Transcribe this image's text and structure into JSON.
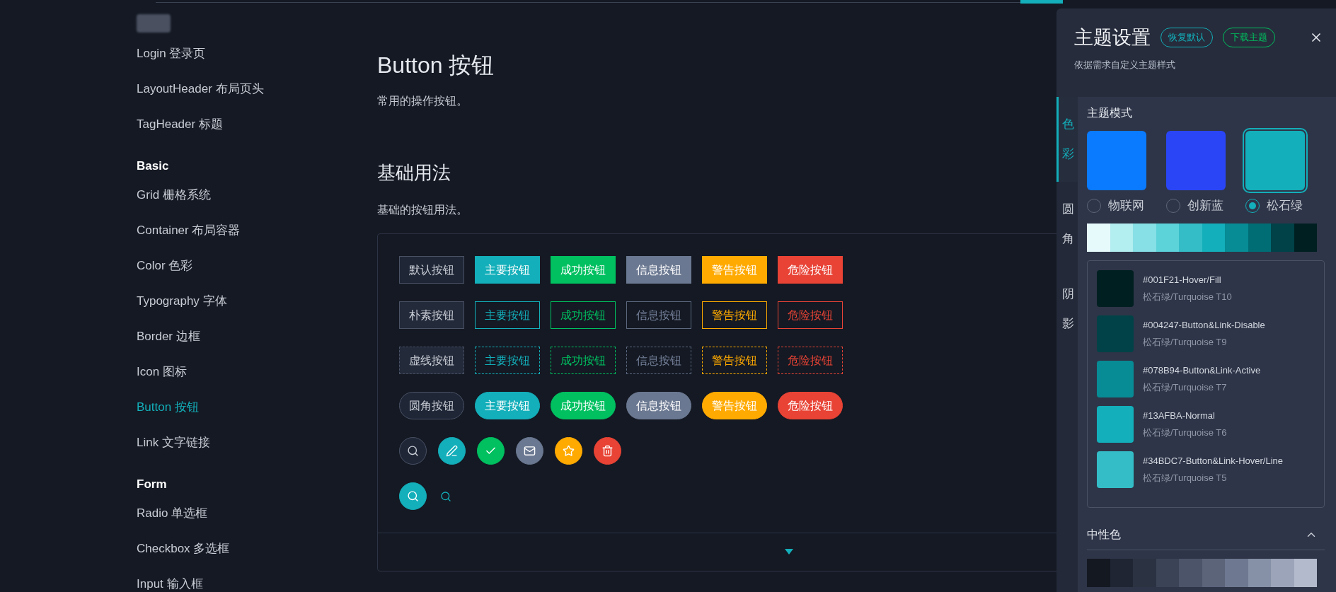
{
  "sidebar": {
    "items": [
      {
        "kind": "link",
        "label": "Login 登录页",
        "selected": false
      },
      {
        "kind": "link",
        "label": "LayoutHeader 布局页头",
        "selected": false
      },
      {
        "kind": "link",
        "label": "TagHeader 标题",
        "selected": false
      },
      {
        "kind": "heading",
        "label": "Basic"
      },
      {
        "kind": "link",
        "label": "Grid 栅格系统",
        "selected": false
      },
      {
        "kind": "link",
        "label": "Container 布局容器",
        "selected": false
      },
      {
        "kind": "link",
        "label": "Color 色彩",
        "selected": false
      },
      {
        "kind": "link",
        "label": "Typography 字体",
        "selected": false
      },
      {
        "kind": "link",
        "label": "Border 边框",
        "selected": false
      },
      {
        "kind": "link",
        "label": "Icon 图标",
        "selected": false
      },
      {
        "kind": "link",
        "label": "Button 按钮",
        "selected": true
      },
      {
        "kind": "link",
        "label": "Link 文字链接",
        "selected": false
      },
      {
        "kind": "heading",
        "label": "Form"
      },
      {
        "kind": "link",
        "label": "Radio 单选框",
        "selected": false
      },
      {
        "kind": "link",
        "label": "Checkbox 多选框",
        "selected": false
      },
      {
        "kind": "link",
        "label": "Input 输入框",
        "selected": false
      }
    ]
  },
  "page": {
    "title": "Button 按钮",
    "description": "常用的操作按钮。",
    "section": {
      "title": "基础用法",
      "description": "基础的按钮用法。",
      "demo": {
        "button_rows": [
          {
            "kind": "solid",
            "buttons": [
              {
                "kind": "default",
                "label": "默认按钮"
              },
              {
                "kind": "primary",
                "label": "主要按钮"
              },
              {
                "kind": "success",
                "label": "成功按钮"
              },
              {
                "kind": "info",
                "label": "信息按钮"
              },
              {
                "kind": "warning",
                "label": "警告按钮"
              },
              {
                "kind": "danger",
                "label": "危险按钮"
              }
            ]
          },
          {
            "kind": "plain",
            "buttons": [
              {
                "kind": "default",
                "label": "朴素按钮"
              },
              {
                "kind": "primary",
                "label": "主要按钮"
              },
              {
                "kind": "success",
                "label": "成功按钮"
              },
              {
                "kind": "info",
                "label": "信息按钮"
              },
              {
                "kind": "warning",
                "label": "警告按钮"
              },
              {
                "kind": "danger",
                "label": "危险按钮"
              }
            ]
          },
          {
            "kind": "dashed",
            "buttons": [
              {
                "kind": "default",
                "label": "虚线按钮"
              },
              {
                "kind": "primary",
                "label": "主要按钮"
              },
              {
                "kind": "success",
                "label": "成功按钮"
              },
              {
                "kind": "info",
                "label": "信息按钮"
              },
              {
                "kind": "warning",
                "label": "警告按钮"
              },
              {
                "kind": "danger",
                "label": "危险按钮"
              }
            ]
          },
          {
            "kind": "round",
            "buttons": [
              {
                "kind": "default",
                "label": "圆角按钮"
              },
              {
                "kind": "primary",
                "label": "主要按钮"
              },
              {
                "kind": "success",
                "label": "成功按钮"
              },
              {
                "kind": "info",
                "label": "信息按钮"
              },
              {
                "kind": "warning",
                "label": "警告按钮"
              },
              {
                "kind": "danger",
                "label": "危险按钮"
              }
            ]
          }
        ],
        "icon_rows": [
          [
            {
              "kind": "search"
            },
            {
              "kind": "edit"
            },
            {
              "kind": "check"
            },
            {
              "kind": "mail"
            },
            {
              "kind": "star"
            },
            {
              "kind": "delete"
            }
          ],
          [
            {
              "kind": "search"
            },
            {
              "kind": "search"
            }
          ]
        ],
        "code_expanded": false
      }
    }
  },
  "theme_panel": {
    "title": "主题设置",
    "buttons": [
      {
        "label": "恢复默认",
        "kind": "primary"
      },
      {
        "label": "下载主题",
        "kind": "success"
      }
    ],
    "subtitle": "依据需求自定义主题样式",
    "side_tabs": [
      {
        "label": "色彩",
        "selected": true
      },
      {
        "label": "圆角",
        "selected": false
      },
      {
        "label": "阴影",
        "selected": false
      }
    ],
    "mode": {
      "title": "主题模式",
      "options": [
        {
          "label": "物联网",
          "color": "#0a7aff",
          "selected": false
        },
        {
          "label": "创新蓝",
          "color": "#2a45f5",
          "selected": false
        },
        {
          "label": "松石绿",
          "color": "#13afba",
          "selected": true
        }
      ]
    },
    "palette": [
      {
        "color": "#e6fafb"
      },
      {
        "color": "#b3eef1"
      },
      {
        "color": "#86e0e5"
      },
      {
        "color": "#5cd2d9"
      },
      {
        "color": "#34bdc7"
      },
      {
        "color": "#13afba"
      },
      {
        "color": "#078b94"
      },
      {
        "color": "#006d75"
      },
      {
        "color": "#004247"
      },
      {
        "color": "#001f21"
      }
    ],
    "color_list": [
      {
        "color": "#001f21",
        "name": "#001F21-Hover/Fill",
        "level_name": "松石绿/Turquoise T10"
      },
      {
        "color": "#004247",
        "name": "#004247-Button&Link-Disable",
        "level_name": "松石绿/Turquoise T9"
      },
      {
        "color": "#078b94",
        "name": "#078B94-Button&Link-Active",
        "level_name": "松石绿/Turquoise T7"
      },
      {
        "color": "#13afba",
        "name": "#13AFBA-Normal",
        "level_name": "松石绿/Turquoise T6"
      },
      {
        "color": "#34bdc7",
        "name": "#34BDC7-Button&Link-Hover/Line",
        "level_name": "松石绿/Turquoise T5"
      }
    ],
    "neutral": {
      "title": "中性色",
      "expanded": true,
      "palette": [
        {
          "color": "#141821"
        },
        {
          "color": "#1f2533"
        },
        {
          "color": "#2b3242"
        },
        {
          "color": "#3b4356"
        },
        {
          "color": "#4b5468"
        },
        {
          "color": "#5b6479"
        },
        {
          "color": "#6e7890"
        },
        {
          "color": "#8690a6"
        },
        {
          "color": "#9ba4b8"
        },
        {
          "color": "#b2bacb"
        }
      ]
    }
  }
}
